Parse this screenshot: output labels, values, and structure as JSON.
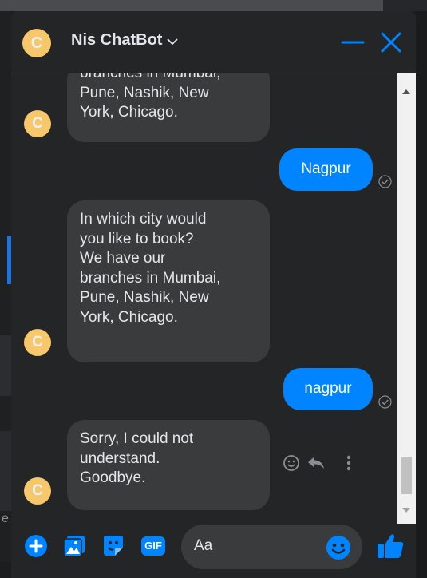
{
  "colors": {
    "accent": "#0084ff",
    "bot_bubble": "#3a3b3c",
    "avatar": "#f7c86b",
    "window_bg": "#242526"
  },
  "header": {
    "avatar_letter": "C",
    "title": "Nis ChatBot"
  },
  "messages": [
    {
      "from": "bot",
      "text": "branches in Mumbai,\nPune, Nashik, New\nYork, Chicago.",
      "avatar_letter": "C"
    },
    {
      "from": "user",
      "text": "Nagpur"
    },
    {
      "from": "bot",
      "text": "In which city would\nyou like to book?\nWe have our\nbranches in Mumbai,\nPune, Nashik, New\nYork, Chicago.",
      "avatar_letter": "C"
    },
    {
      "from": "user",
      "text": "nagpur"
    },
    {
      "from": "bot",
      "text": "Sorry, I could not\nunderstand.\nGoodbye.",
      "avatar_letter": "C"
    }
  ],
  "background": {
    "edge_letter": "e"
  },
  "composer": {
    "placeholder": "Aa",
    "gif_label": "GIF",
    "icons": [
      "plus-icon",
      "image-icon",
      "sticker-icon",
      "gif-icon",
      "emoji-icon",
      "thumbs-up-icon"
    ]
  }
}
